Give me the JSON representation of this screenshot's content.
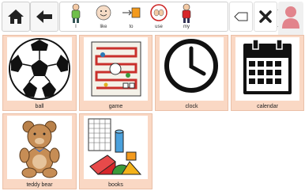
{
  "sentence_strip": {
    "words": [
      {
        "label": "I",
        "icon": "person-pointing-self-icon"
      },
      {
        "label": "like",
        "icon": "smiling-face-icon"
      },
      {
        "label": "to",
        "icon": "arrow-to-box-icon"
      },
      {
        "label": "use",
        "icon": "hands-using-icon"
      },
      {
        "label": "my",
        "icon": "person-my-icon"
      }
    ]
  },
  "toolbar": {
    "dropdown_glyph": "▾",
    "user_label": "user"
  },
  "colors": {
    "tile_bg": "#fad8c4",
    "tile_border": "#eac0a8",
    "clear_icon": "#222222"
  },
  "tiles": [
    {
      "label": "ball",
      "icon": "soccer-ball-icon"
    },
    {
      "label": "game",
      "icon": "board-game-icon"
    },
    {
      "label": "clock",
      "icon": "clock-icon"
    },
    {
      "label": "calendar",
      "icon": "calendar-icon"
    },
    {
      "label": "teddy bear",
      "icon": "teddy-bear-icon"
    },
    {
      "label": "books",
      "icon": "books-icon"
    }
  ]
}
